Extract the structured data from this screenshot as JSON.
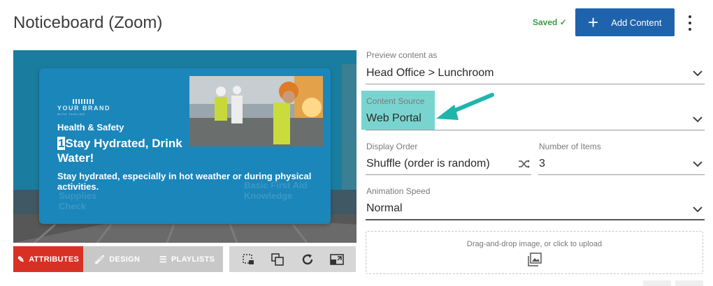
{
  "header": {
    "title": "Noticeboard (Zoom)",
    "saved_label": "Saved",
    "add_button_label": "Add Content"
  },
  "preview": {
    "brand": "YOUR BRAND",
    "brand_sub": "WITH TAGLINE",
    "category": "Health & Safety",
    "headline_number": "1",
    "headline": "Stay Hydrated, Drink Water!",
    "body": "Stay hydrated, especially in hot weather or during physical activities.",
    "ghost_left": "Supplies Check",
    "ghost_right": "Basic First Aid Knowledge"
  },
  "tabs": [
    {
      "label": "ATTRIBUTES",
      "icon": "edit-icon"
    },
    {
      "label": "DESIGN",
      "icon": "brush-icon"
    },
    {
      "label": "PLAYLISTS",
      "icon": "list-icon"
    }
  ],
  "tools": [
    "crop-icon",
    "layers-icon",
    "refresh-icon",
    "resize-icon"
  ],
  "form": {
    "preview_as": {
      "label": "Preview content as",
      "value": "Head Office > Lunchroom"
    },
    "content_source": {
      "label": "Content Source",
      "value": "Web Portal"
    },
    "display_order": {
      "label": "Display Order",
      "value": "Shuffle (order is random)",
      "icon": "shuffle-icon"
    },
    "number_of_items": {
      "label": "Number of Items",
      "value": "3"
    },
    "animation_speed": {
      "label": "Animation Speed",
      "value": "Normal"
    }
  },
  "dropzone": {
    "text": "Drag-and-drop image, or click to upload",
    "icon": "image-icon"
  },
  "colors": {
    "primary": "#1f63ad",
    "danger": "#d93025",
    "success": "#3a9a46",
    "highlight": "#4cc5c0",
    "arrow": "#1fb5ad"
  }
}
